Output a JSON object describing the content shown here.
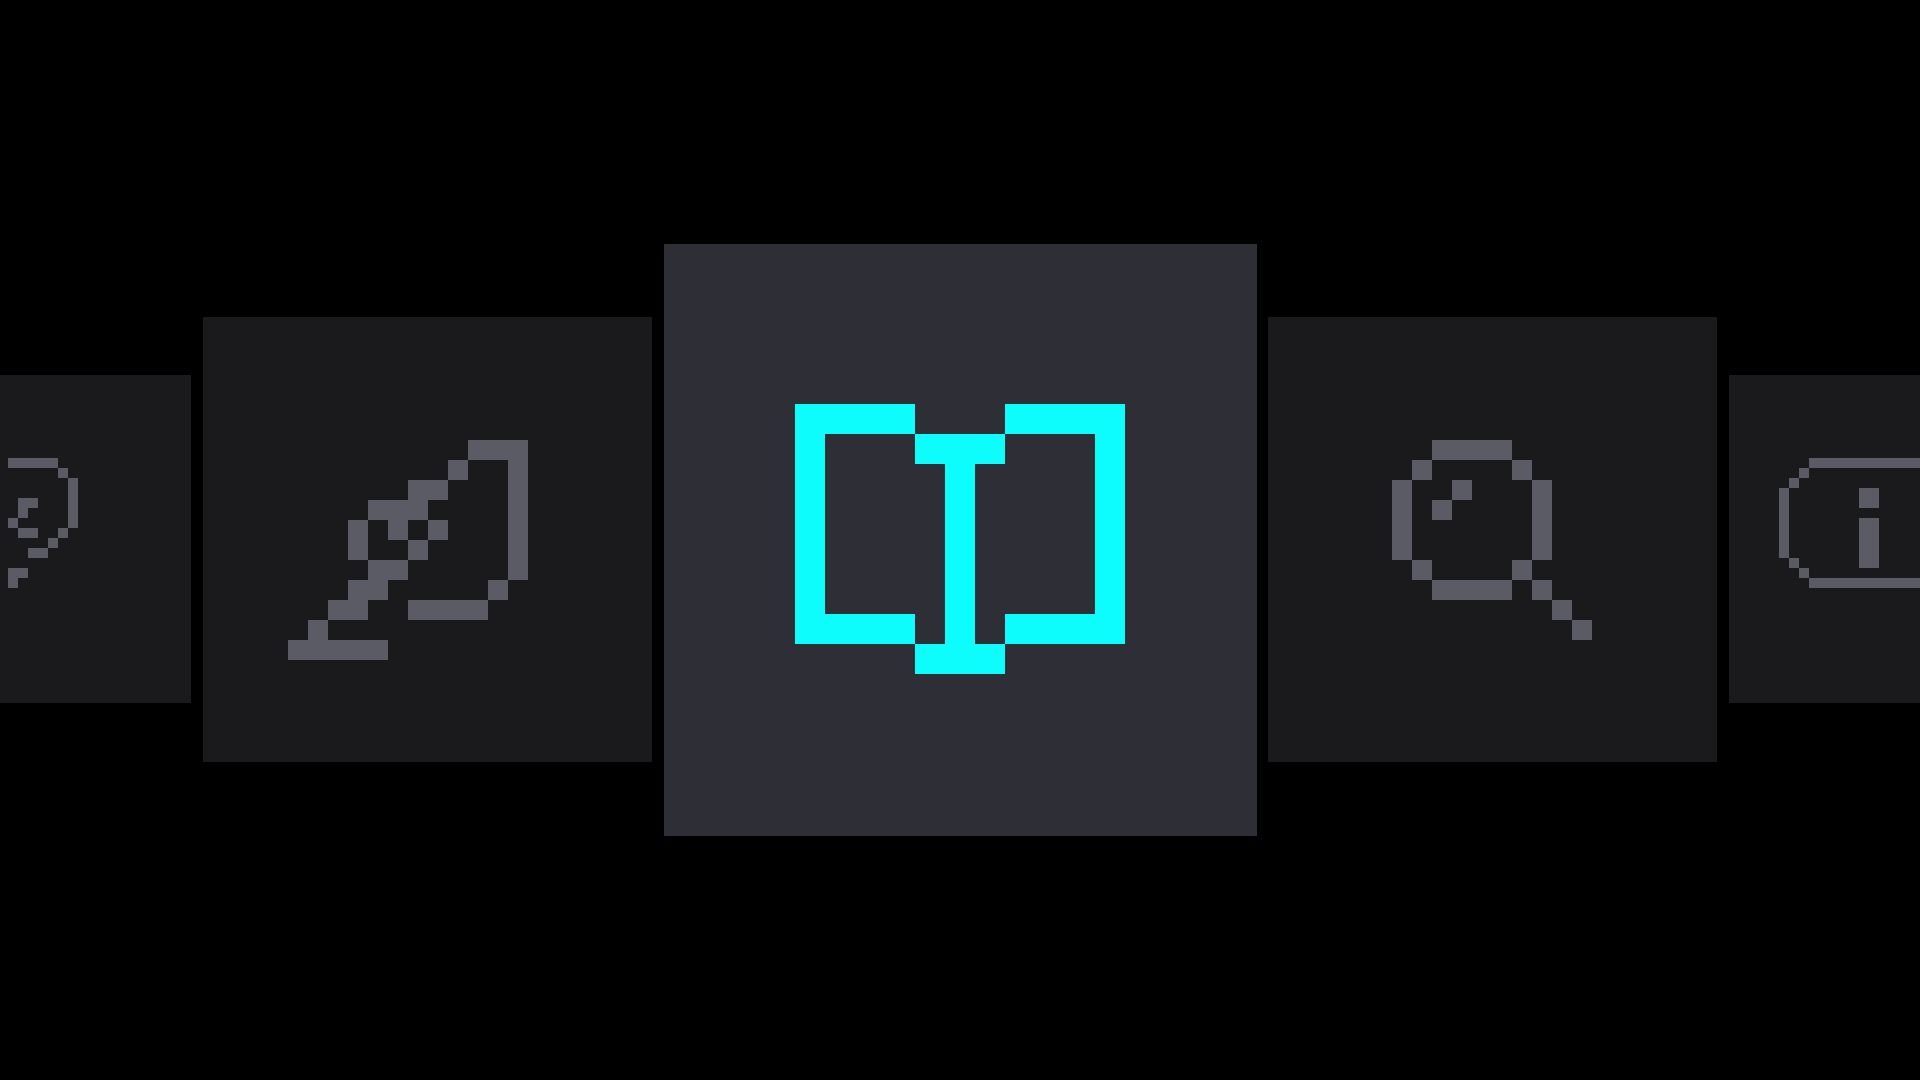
{
  "carousel": {
    "selected_index": 2,
    "colors": {
      "background": "#000000",
      "tile_inactive": "#1a1a1d",
      "tile_active": "#2e2e37",
      "icon_inactive": "#5b5b66",
      "icon_active": "#0dfcfc"
    },
    "items": [
      {
        "icon": "help-icon",
        "state": "inactive"
      },
      {
        "icon": "quill-pen-icon",
        "state": "inactive"
      },
      {
        "icon": "open-book-icon",
        "state": "active"
      },
      {
        "icon": "magnifying-glass-icon",
        "state": "inactive"
      },
      {
        "icon": "info-icon",
        "state": "inactive"
      }
    ]
  }
}
